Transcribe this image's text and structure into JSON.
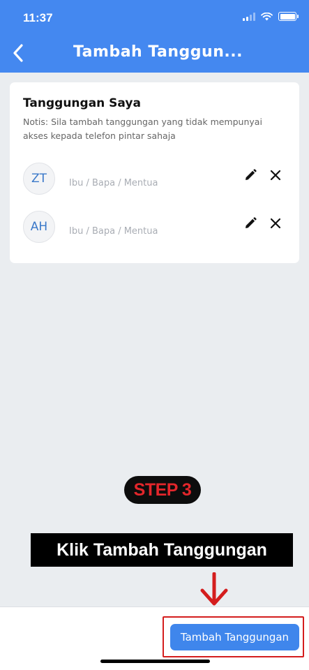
{
  "status_bar": {
    "time": "11:37"
  },
  "header": {
    "title": "Tambah Tanggun..."
  },
  "card": {
    "title": "Tanggungan Saya",
    "note": "Notis: Sila tambah tanggungan yang tidak mempunyai akses kepada telefon pintar sahaja",
    "dependents": [
      {
        "initials": "ZT",
        "relation": "Ibu / Bapa / Mentua"
      },
      {
        "initials": "AH",
        "relation": "Ibu / Bapa / Mentua"
      }
    ]
  },
  "overlay": {
    "step_label": "STEP 3",
    "instruction": "Klik Tambah Tanggungan"
  },
  "footer": {
    "add_button_label": "Tambah Tanggungan"
  },
  "colors": {
    "header_blue": "#4488f0",
    "button_blue": "#3f86ec",
    "highlight_red": "#d41d1d",
    "step_red": "#e3262b"
  }
}
